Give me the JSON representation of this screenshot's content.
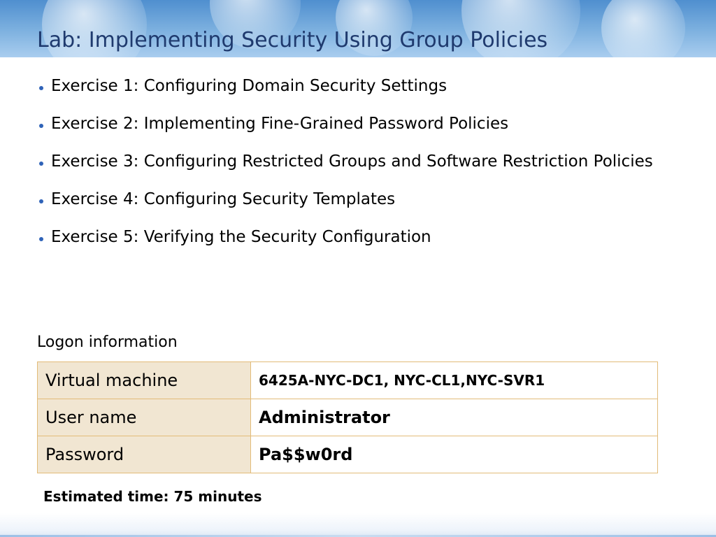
{
  "slide": {
    "title": "Lab: Implementing Security Using Group Policies"
  },
  "exercises": [
    "Exercise 1: Configuring Domain Security Settings",
    "Exercise 2: Implementing Fine-Grained Password Policies",
    "Exercise 3: Configuring Restricted Groups and Software Restriction Policies",
    "Exercise 4: Configuring Security Templates",
    "Exercise 5: Verifying the Security Configuration"
  ],
  "logon": {
    "heading": "Logon information",
    "rows": [
      {
        "label": "Virtual machine",
        "value": "6425A-NYC-DC1, NYC-CL1,NYC-SVR1"
      },
      {
        "label": "User name",
        "value": "Administrator"
      },
      {
        "label": "Password",
        "value": "Pa$$w0rd"
      }
    ]
  },
  "estimated_time": "Estimated time: 75 minutes",
  "colors": {
    "title": "#1f3a6e",
    "header_band": "#7fb2e0",
    "bullet": "#2f63b8",
    "table_label_fill": "#f1e6d2",
    "table_border": "#e2bb78"
  }
}
